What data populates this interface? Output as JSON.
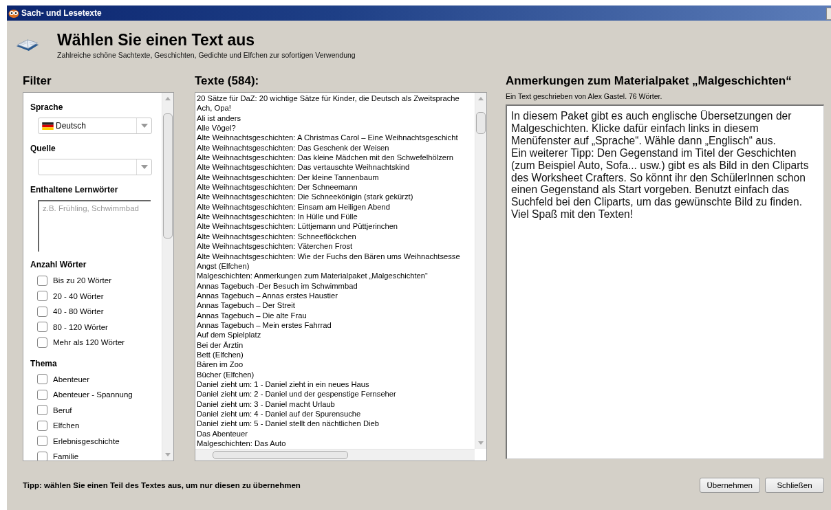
{
  "window": {
    "title": "Sach- und Lesetexte"
  },
  "header": {
    "title": "Wählen Sie einen Text aus",
    "subtitle": "Zahlreiche schöne Sachtexte, Geschichten, Gedichte und Elfchen zur sofortigen Verwendung"
  },
  "filter": {
    "heading": "Filter",
    "language": {
      "label": "Sprache",
      "value": "Deutsch"
    },
    "source": {
      "label": "Quelle"
    },
    "words": {
      "label": "Enthaltene Lernwörter",
      "placeholder": "z.B. Frühling, Schwimmbad"
    },
    "groups": [
      {
        "label": "Anzahl Wörter",
        "options": [
          {
            "label": "Bis zu 20 Wörter",
            "checked": false
          },
          {
            "label": "20 - 40 Wörter",
            "checked": false
          },
          {
            "label": "40 - 80 Wörter",
            "checked": false
          },
          {
            "label": "80 - 120 Wörter",
            "checked": false
          },
          {
            "label": "Mehr als 120 Wörter",
            "checked": false
          }
        ]
      },
      {
        "label": "Thema",
        "options": [
          {
            "label": "Abenteuer",
            "checked": false
          },
          {
            "label": "Abenteuer - Spannung",
            "checked": false
          },
          {
            "label": "Beruf",
            "checked": false
          },
          {
            "label": "Elfchen",
            "checked": false
          },
          {
            "label": "Erlebnisgeschichte",
            "checked": false
          },
          {
            "label": "Familie",
            "checked": false
          }
        ]
      }
    ]
  },
  "texts": {
    "heading": "Texte (584):",
    "items": [
      "20 Sätze für DaZ: 20 wichtige Sätze für Kinder, die Deutsch als Zweitsprache",
      "Ach, Opa!",
      "Ali ist anders",
      "Alle Vögel?",
      "Alte Weihnachtsgeschichten: A Christmas Carol – Eine Weihnachtsgeschicht",
      "Alte Weihnachtsgeschichten: Das Geschenk der Weisen",
      "Alte Weihnachtsgeschichten: Das kleine Mädchen mit den Schwefelhölzern",
      "Alte Weihnachtsgeschichten: Das vertauschte Weihnachtskind",
      "Alte Weihnachtsgeschichten: Der kleine Tannenbaum",
      "Alte Weihnachtsgeschichten: Der Schneemann",
      "Alte Weihnachtsgeschichten: Die Schneekönigin (stark gekürzt)",
      "Alte Weihnachtsgeschichten: Einsam am Heiligen Abend",
      "Alte Weihnachtsgeschichten: In Hülle und Fülle",
      "Alte Weihnachtsgeschichten: Lüttjemann und Püttjerinchen",
      "Alte Weihnachtsgeschichten: Schneeflöckchen",
      "Alte Weihnachtsgeschichten: Väterchen Frost",
      "Alte Weihnachtsgeschichten: Wie der Fuchs den Bären ums Weihnachtsesse",
      "Angst (Elfchen)",
      "Malgeschichten: Anmerkungen zum Materialpaket „Malgeschichten“",
      "Annas Tagebuch -Der Besuch im Schwimmbad",
      "Annas Tagebuch – Annas erstes Haustier",
      "Annas Tagebuch – Der Streit",
      "Annas Tagebuch – Die alte Frau",
      "Annas Tagebuch – Mein erstes Fahrrad",
      "Auf dem Spielplatz",
      "Bei der Ärztin",
      "Bett (Elfchen)",
      "Bären im Zoo",
      "Bücher (Elfchen)",
      "Daniel zieht um: 1 - Daniel zieht in ein neues Haus",
      "Daniel zieht um: 2 - Daniel und der gespenstige Fernseher",
      "Daniel zieht um: 3 - Daniel macht Urlaub",
      "Daniel zieht um: 4 - Daniel auf der Spurensuche",
      "Daniel zieht um: 5 - Daniel stellt den nächtlichen Dieb",
      "Das Abenteuer",
      "Malgeschichten: Das Auto"
    ]
  },
  "notes": {
    "heading": "Anmerkungen zum Materialpaket „Malgeschichten“",
    "meta": "Ein Text geschrieben von Alex Gastel. 76 Wörter.",
    "body": "In diesem Paket gibt es auch englische Übersetzungen der Malgeschichten. Klicke dafür einfach links in diesem Menüfenster auf „Sprache“. Wähle dann „Englisch“ aus.\nEin weiterer Tipp: Den Gegenstand im Titel der Geschichten (zum Beispiel Auto, Sofa... usw.) gibt es als Bild in den Cliparts des Worksheet Crafters. So könnt ihr den SchülerInnen schon einen Gegenstand als Start vorgeben. Benutzt einfach das Suchfeld bei den Cliparts, um das gewünschte Bild zu finden.\nViel Spaß mit den Texten!"
  },
  "footer": {
    "tip": "Tipp: wählen Sie einen Teil des Textes aus, um nur diesen zu übernehmen",
    "buttons": [
      "Übernehmen",
      "Schließen"
    ]
  }
}
